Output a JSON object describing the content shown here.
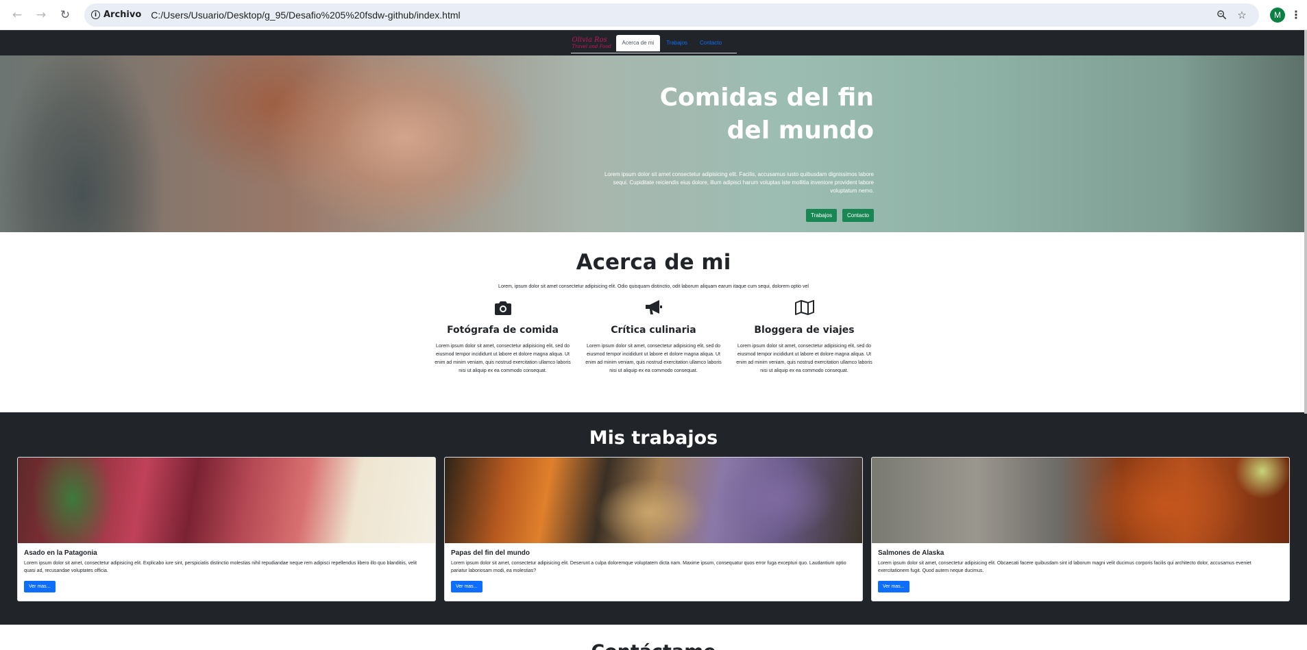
{
  "browser": {
    "security_label": "Archivo",
    "url": "C:/Users/Usuario/Desktop/g_95/Desafio%205%20fsdw-github/index.html",
    "avatar_letter": "M"
  },
  "nav": {
    "brand_line1": "Olivia Ros",
    "brand_line2": "Travel and Food",
    "tabs": [
      {
        "label": "Acerca de mi"
      },
      {
        "label": "Trabajos"
      },
      {
        "label": "Contacto"
      }
    ]
  },
  "hero": {
    "title_line1": "Comidas del fin",
    "title_line2": "del mundo",
    "text": "Lorem ipsum dolor sit amet consectetur adipisicing elit. Facilis, accusamus iusto quibusdam dignissimos labore sequi. Cupiditate reiciendis eius dolore, illum adipisci harum voluptas iste mollitia inventore provident labore voluptatum nemo.",
    "buttons": [
      {
        "label": "Trabajos"
      },
      {
        "label": "Contacto"
      }
    ]
  },
  "about": {
    "title": "Acerca de mi",
    "lead": "Lorem, ipsum dolor sit amet consectetur adipisicing elit. Odio quisquam distinctio, odit laborum aliquam earum itaque cum sequi, dolorem optio vel",
    "features": [
      {
        "icon": "camera-icon",
        "title": "Fotógrafa de comida",
        "text": "Lorem ipsum dolor sit amet, consectetur adipisicing elit, sed do eiusmod tempor incididunt ut labore et dolore magna aliqua. Ut enim ad minim veniam, quis nostrud exercitation ullamco laboris nisi ut aliquip ex ea commodo consequat."
      },
      {
        "icon": "megaphone-icon",
        "title": "Crítica culinaria",
        "text": "Lorem ipsum dolor sit amet, consectetur adipisicing elit, sed do eiusmod tempor incididunt ut labore et dolore magna aliqua. Ut enim ad minim veniam, quis nostrud exercitation ullamco laboris nisi ut aliquip ex ea commodo consequat."
      },
      {
        "icon": "map-icon",
        "title": "Bloggera de viajes",
        "text": "Lorem ipsum dolor sit amet, consectetur adipisicing elit, sed do eiusmod tempor incididunt ut labore et dolore magna aliqua. Ut enim ad minim veniam, quis nostrud exercitation ullamco laboris nisi ut aliquip ex ea commodo consequat."
      }
    ]
  },
  "works": {
    "title": "Mis trabajos",
    "cards": [
      {
        "title": "Asado en la Patagonia",
        "text": "Lorem ipsum dolor sit amet, consectetur adipisicing elit. Explicabo iure sint, perspiciatis distinctio molestias nihil repudiandae neque rem adipisci repellendus libero illo quo blanditiis, velit quasi ad, recusandae voluptates officia.",
        "button": "Ver mas..."
      },
      {
        "title": "Papas del fin del mundo",
        "text": "Lorem ipsum dolor sit amet, consectetur adipisicing elit. Deserunt a culpa doloremque voluptatem dicta nam. Maxime ipsum, consequatur quos error fuga excepturi quo. Laudantium optio pariatur laboriosam modi, ea molestias?",
        "button": "Ver mas..."
      },
      {
        "title": "Salmones de Alaska",
        "text": "Lorem ipsum dolor sit amet, consectetur adipisicing elit. Obcaecati facere quibusdam sint id laborum magni velit ducimus corporis facilis qui architecto dolor, accusamus eveniet exercitationem fugit. Quod autem neque ducimus.",
        "button": "Ver mas..."
      }
    ]
  },
  "contact": {
    "title": "Contáctame"
  }
}
